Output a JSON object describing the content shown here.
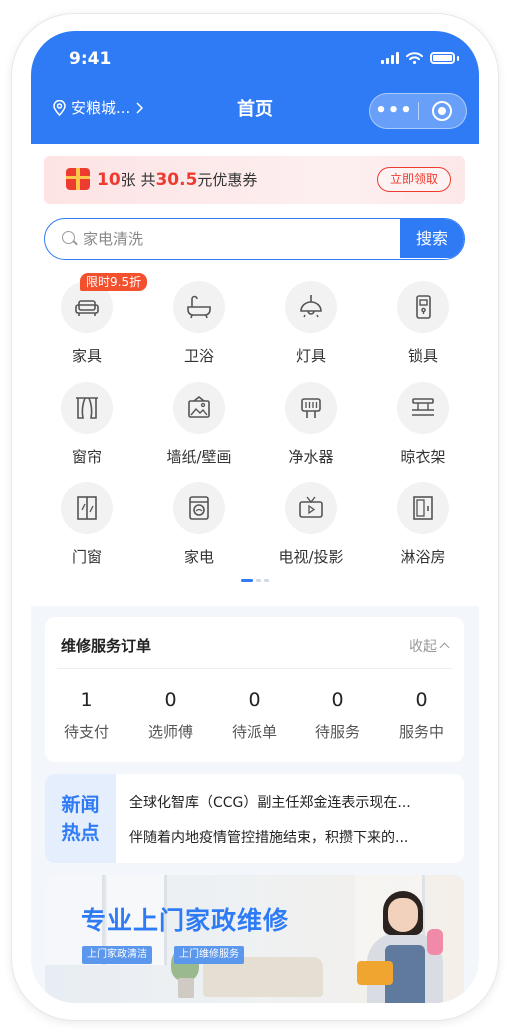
{
  "status_bar": {
    "time": "9:41"
  },
  "nav": {
    "location": "安粮城...",
    "title": "首页",
    "more": "•••"
  },
  "coupon": {
    "count": "10",
    "unit": "张 共",
    "amount": "30.5",
    "suffix": "元优惠券",
    "button": "立即领取"
  },
  "search": {
    "placeholder": "家电清洗",
    "button": "搜索"
  },
  "categories": {
    "promo_tag": "限时9.5折",
    "items": [
      {
        "label": "家具",
        "icon": "sofa-icon"
      },
      {
        "label": "卫浴",
        "icon": "bathtub-icon"
      },
      {
        "label": "灯具",
        "icon": "ceiling-lamp-icon"
      },
      {
        "label": "锁具",
        "icon": "door-lock-icon"
      },
      {
        "label": "窗帘",
        "icon": "curtain-icon"
      },
      {
        "label": "墙纸/壁画",
        "icon": "wallpaper-icon"
      },
      {
        "label": "净水器",
        "icon": "water-purifier-icon"
      },
      {
        "label": "晾衣架",
        "icon": "clothes-rack-icon"
      },
      {
        "label": "门窗",
        "icon": "door-window-icon"
      },
      {
        "label": "家电",
        "icon": "washing-machine-icon"
      },
      {
        "label": "电视/投影",
        "icon": "tv-icon"
      },
      {
        "label": "淋浴房",
        "icon": "shower-room-icon"
      }
    ]
  },
  "orders": {
    "title": "维修服务订单",
    "collapse": "收起",
    "stats": [
      {
        "count": "1",
        "label": "待支付"
      },
      {
        "count": "0",
        "label": "选师傅"
      },
      {
        "count": "0",
        "label": "待派单"
      },
      {
        "count": "0",
        "label": "待服务"
      },
      {
        "count": "0",
        "label": "服务中"
      }
    ]
  },
  "news": {
    "label_line1": "新闻",
    "label_line2": "热点",
    "items": [
      "全球化智库（CCG）副主任郑金连表示现在...",
      "伴随着内地疫情管控措施结束，积攒下来的..."
    ]
  },
  "banner": {
    "title": "专业上门家政维修",
    "tags": [
      "上门家政清洁",
      "上门维修服务"
    ]
  },
  "colors": {
    "primary": "#2f7bf6",
    "accent_red": "#ee3b2f"
  }
}
